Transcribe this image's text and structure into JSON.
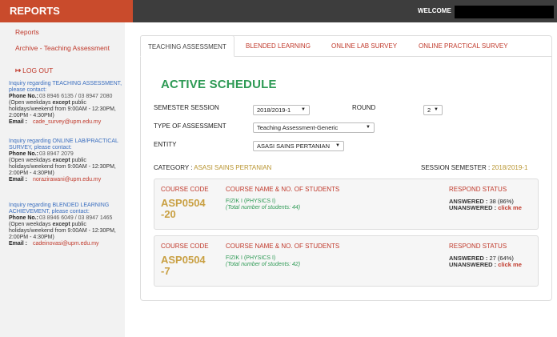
{
  "header": {
    "brand": "REPORTS",
    "welcome": "WELCOME",
    "colors": {
      "brand": "#c94b2c",
      "bar": "#3d3d3d"
    }
  },
  "sidebar": {
    "reports": "Reports",
    "archive": "Archive - Teaching Assessment",
    "logout_icon": "logout-icon",
    "logout": "LOG OUT",
    "inquiries": [
      {
        "title": "Inquiry regarding TEACHING ASSESSMENT, please contact:",
        "phone_label": "Phone No.:",
        "phone": "03 8946 6135 / 03 8947 2080",
        "hours_pre": "(Open weekdays ",
        "hours_bold": "except",
        "hours_post": " public holidays/weekend from 9:00AM - 12:30PM, 2:00PM - 4:30PM)",
        "email_label": "Email :",
        "email": "cade_survey@upm.edu.my"
      },
      {
        "title": "Inquiry regarding ONLINE LAB/PRACTICAL SURVEY, please contact:",
        "phone_label": "Phone No.:",
        "phone": "03 8947 2079",
        "hours_pre": "(Open weekdays ",
        "hours_bold": "except",
        "hours_post": " public holidays/weekend from 9:00AM - 12:30PM, 2:00PM - 4:30PM)",
        "email_label": "Email :",
        "email": "norazirawani@upm.edu.my"
      },
      {
        "title": "Inquiry regarding BLENDED LEARNING ACHIEVEMENT, please contact:",
        "phone_label": "Phone No.:",
        "phone": "03 8946 6049 / 03 8947 1465",
        "hours_pre": "(Open weekdays ",
        "hours_bold": "except",
        "hours_post": " public holidays/weekend from 9:00AM - 12:30PM, 2:00PM - 4:30PM)",
        "email_label": "Email :",
        "email": "cadeinovasi@upm.edu.my"
      }
    ]
  },
  "tabs": [
    "TEACHING ASSESSMENT",
    "BLENDED LEARNING",
    "ONLINE LAB SURVEY",
    "ONLINE PRACTICAL SURVEY"
  ],
  "main": {
    "heading": "ACTIVE SCHEDULE",
    "filters": {
      "semester_label": "SEMESTER SESSION",
      "semester_value": "2018/2019-1",
      "round_label": "ROUND",
      "round_value": "2",
      "type_label": "TYPE OF ASSESSMENT",
      "type_value": "Teaching Assessment-Generic",
      "entity_label": "ENTITY",
      "entity_value": "ASASI SAINS PERTANIAN"
    },
    "category_label": "CATEGORY :",
    "category_value": "ASASI SAINS PERTANIAN",
    "session_label": "SESSION SEMESTER :",
    "session_value": "2018/2019-1",
    "col_headers": {
      "code": "COURSE CODE",
      "name": "COURSE NAME & NO. OF STUDENTS",
      "status": "RESPOND STATUS"
    },
    "courses": [
      {
        "code": "ASP0504 -20",
        "name": "FIZIK I (PHYSICS I)",
        "students": "(Total number of students: 44)",
        "answered_label": "ANSWERED :",
        "answered": "38 (86%)",
        "unanswered_label": "UNANSWERED :",
        "click": "click me"
      },
      {
        "code": "ASP0504 -7",
        "name": "FIZIK I (PHYSICS I)",
        "students": "(Total number of students: 42)",
        "answered_label": "ANSWERED :",
        "answered": "27 (64%)",
        "unanswered_label": "UNANSWERED :",
        "click": "click me"
      }
    ]
  }
}
